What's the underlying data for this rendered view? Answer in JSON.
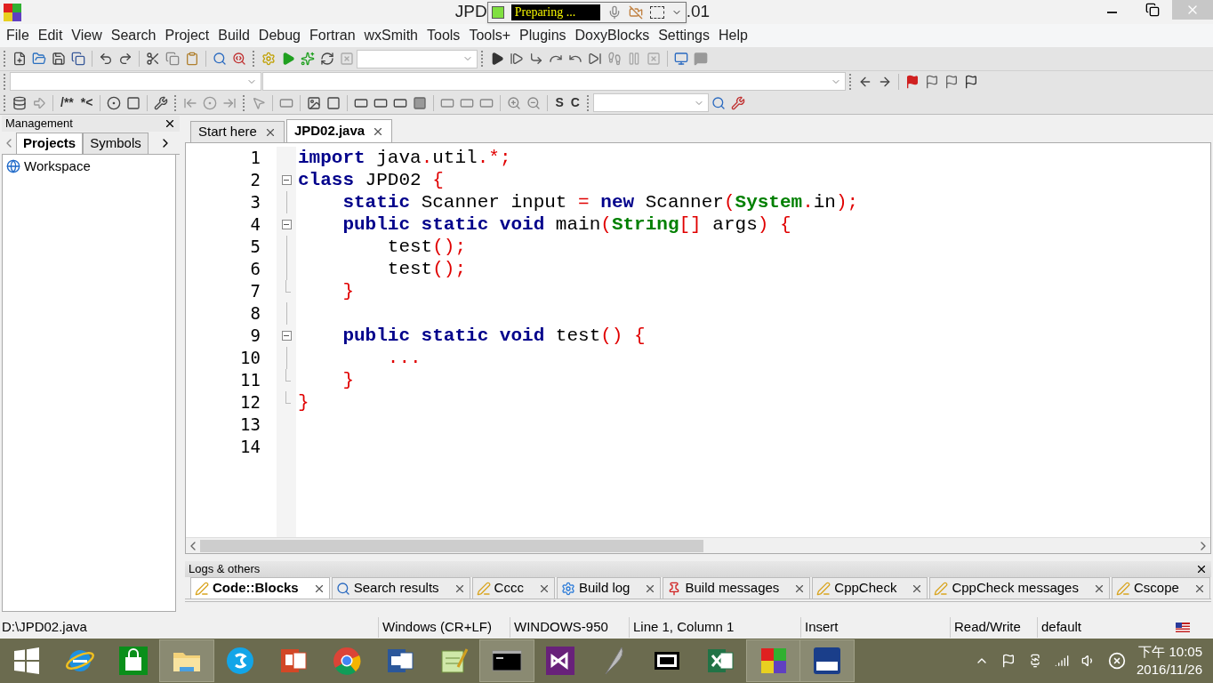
{
  "window": {
    "title_start": "JPD",
    "title_end": ".01"
  },
  "recorder": {
    "status": "Preparing ..."
  },
  "menu": [
    "File",
    "Edit",
    "View",
    "Search",
    "Project",
    "Build",
    "Debug",
    "Fortran",
    "wxSmith",
    "Tools",
    "Tools+",
    "Plugins",
    "DoxyBlocks",
    "Settings",
    "Help"
  ],
  "toolbar_texts": {
    "doc_comment": "/**",
    "line_comment": "*<",
    "symbol_s": "S",
    "symbol_c": "C"
  },
  "management": {
    "title": "Management",
    "tabs": [
      {
        "label": "Projects",
        "selected": true
      },
      {
        "label": "Symbols",
        "selected": false
      }
    ],
    "tree": [
      {
        "label": "Workspace"
      }
    ]
  },
  "editor": {
    "tabs": [
      {
        "label": "Start here",
        "selected": false
      },
      {
        "label": "JPD02.java",
        "selected": true
      }
    ],
    "lines": [
      {
        "n": "1",
        "kind": "plain",
        "tokens": [
          {
            "kind": "keyword",
            "text": "import"
          },
          {
            "kind": "plain",
            "text": " java"
          },
          {
            "kind": "operator",
            "text": "."
          },
          {
            "kind": "plain",
            "text": "util"
          },
          {
            "kind": "operator",
            "text": ".*;"
          }
        ]
      },
      {
        "n": "2",
        "kind": "fold-start",
        "tokens": [
          {
            "kind": "keyword",
            "text": "class"
          },
          {
            "kind": "plain",
            "text": " JPD02 "
          },
          {
            "kind": "operator",
            "text": "{"
          }
        ]
      },
      {
        "n": "3",
        "kind": "fold-body",
        "tokens": [
          {
            "kind": "keyword",
            "text": "    static"
          },
          {
            "kind": "plain",
            "text": " Scanner input "
          },
          {
            "kind": "operator",
            "text": "="
          },
          {
            "kind": "keyword",
            "text": " new"
          },
          {
            "kind": "plain",
            "text": " Scanner"
          },
          {
            "kind": "operator",
            "text": "("
          },
          {
            "kind": "type",
            "text": "System"
          },
          {
            "kind": "operator",
            "text": "."
          },
          {
            "kind": "plain",
            "text": "in"
          },
          {
            "kind": "operator",
            "text": ");"
          }
        ]
      },
      {
        "n": "4",
        "kind": "fold-start",
        "tokens": [
          {
            "kind": "keyword",
            "text": "    public static void"
          },
          {
            "kind": "plain",
            "text": " main"
          },
          {
            "kind": "operator",
            "text": "("
          },
          {
            "kind": "type",
            "text": "String"
          },
          {
            "kind": "operator",
            "text": "[]"
          },
          {
            "kind": "plain",
            "text": " args"
          },
          {
            "kind": "operator",
            "text": ") {"
          }
        ]
      },
      {
        "n": "5",
        "kind": "fold-body",
        "tokens": [
          {
            "kind": "plain",
            "text": "        test"
          },
          {
            "kind": "operator",
            "text": "();"
          }
        ]
      },
      {
        "n": "6",
        "kind": "fold-body",
        "tokens": [
          {
            "kind": "plain",
            "text": "        test"
          },
          {
            "kind": "operator",
            "text": "();"
          }
        ]
      },
      {
        "n": "7",
        "kind": "fold-end",
        "tokens": [
          {
            "kind": "operator",
            "text": "    }"
          }
        ]
      },
      {
        "n": "8",
        "kind": "fold-body"
      },
      {
        "n": "9",
        "kind": "fold-start",
        "tokens": [
          {
            "kind": "keyword",
            "text": "    public static void"
          },
          {
            "kind": "plain",
            "text": " test"
          },
          {
            "kind": "operator",
            "text": "() {"
          }
        ]
      },
      {
        "n": "10",
        "kind": "fold-body",
        "tokens": [
          {
            "kind": "operator",
            "text": "        ..."
          }
        ]
      },
      {
        "n": "11",
        "kind": "fold-end",
        "tokens": [
          {
            "kind": "operator",
            "text": "    }"
          }
        ]
      },
      {
        "n": "12",
        "kind": "fold-end",
        "tokens": [
          {
            "kind": "operator",
            "text": "}"
          }
        ]
      },
      {
        "n": "13",
        "kind": "plain"
      },
      {
        "n": "14",
        "kind": "plain"
      }
    ]
  },
  "logs": {
    "title": "Logs & others",
    "tabs": [
      {
        "label": "Code::Blocks",
        "kind": "note",
        "selected": true
      },
      {
        "label": "Search results",
        "kind": "search",
        "selected": false
      },
      {
        "label": "Cccc",
        "kind": "note",
        "selected": false
      },
      {
        "label": "Build log",
        "kind": "gear",
        "selected": false
      },
      {
        "label": "Build messages",
        "kind": "pin",
        "selected": false
      },
      {
        "label": "CppCheck",
        "kind": "note",
        "selected": false
      },
      {
        "label": "CppCheck messages",
        "kind": "note",
        "selected": false
      },
      {
        "label": "Cscope",
        "kind": "note",
        "selected": false
      }
    ]
  },
  "status_bar": {
    "file": "D:\\JPD02.java",
    "line_endings": "Windows (CR+LF)",
    "encoding": "WINDOWS-950",
    "position": "Line 1, Column 1",
    "mode": "Insert",
    "access": "Read/Write",
    "profile": "default"
  },
  "taskbar": {
    "apps": [
      {
        "kind": "start",
        "active": false
      },
      {
        "kind": "browser-e",
        "active": false
      },
      {
        "kind": "store",
        "active": false
      },
      {
        "kind": "folder",
        "active": true
      },
      {
        "kind": "chat",
        "active": false
      },
      {
        "kind": "slides",
        "active": false
      },
      {
        "kind": "chrome",
        "active": false
      },
      {
        "kind": "word",
        "active": false
      },
      {
        "kind": "notepad",
        "active": false
      },
      {
        "kind": "console",
        "active": true
      },
      {
        "kind": "studio",
        "active": false
      },
      {
        "kind": "feather",
        "active": false
      },
      {
        "kind": "archive",
        "active": false
      },
      {
        "kind": "sheet",
        "active": false
      },
      {
        "kind": "cubes",
        "active": true
      },
      {
        "kind": "pdf",
        "active": true
      }
    ],
    "time": "下午 10:05",
    "date": "2016/11/26"
  }
}
